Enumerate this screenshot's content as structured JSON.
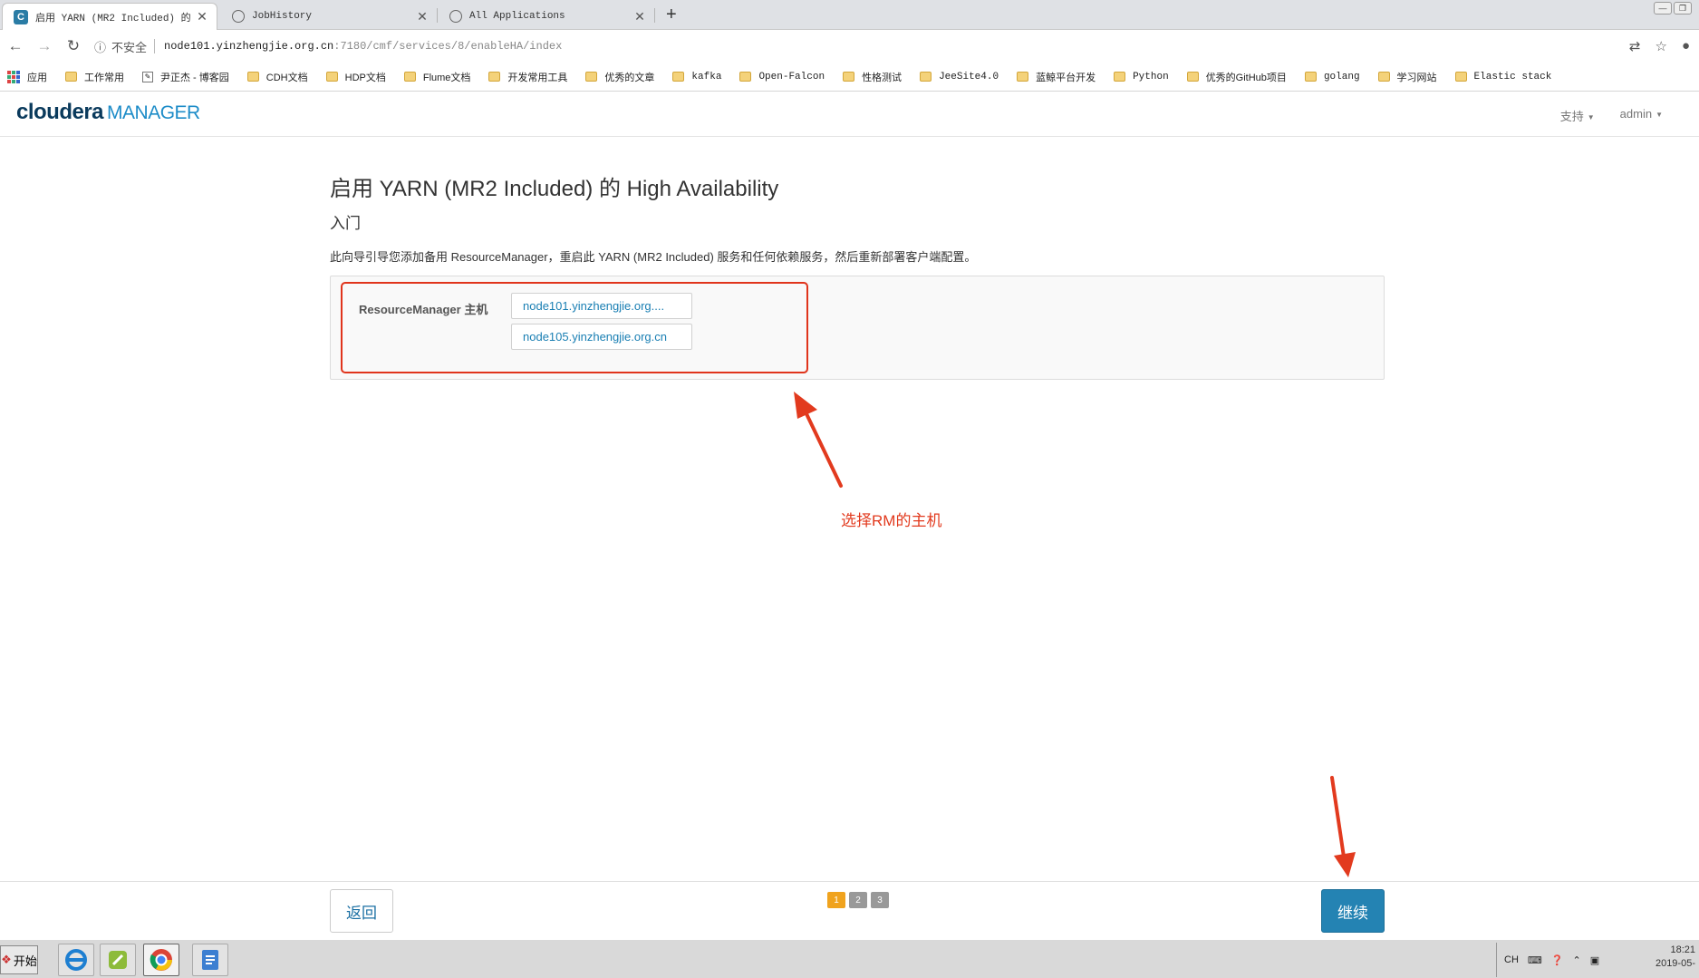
{
  "browser": {
    "tabs": [
      {
        "title": "启用 YARN (MR2 Included) 的 H",
        "active": true,
        "favicon": "cloudera-favicon"
      },
      {
        "title": "JobHistory",
        "active": false,
        "favicon": "globe-icon"
      },
      {
        "title": "All Applications",
        "active": false,
        "favicon": "globe-icon"
      }
    ],
    "new_tab": "+",
    "address": {
      "security": "不安全",
      "host": "node101.yinzhengjie.org.cn",
      "path": ":7180/cmf/services/8/enableHA/index"
    },
    "bookmarks": [
      {
        "label": "应用",
        "type": "apps"
      },
      {
        "label": "工作常用",
        "type": "folder"
      },
      {
        "label": "尹正杰 - 博客园",
        "type": "page"
      },
      {
        "label": "CDH文档",
        "type": "folder"
      },
      {
        "label": "HDP文档",
        "type": "folder"
      },
      {
        "label": "Flume文档",
        "type": "folder"
      },
      {
        "label": "开发常用工具",
        "type": "folder"
      },
      {
        "label": "优秀的文章",
        "type": "folder"
      },
      {
        "label": "kafka",
        "type": "folder"
      },
      {
        "label": "Open-Falcon",
        "type": "folder"
      },
      {
        "label": "性格测试",
        "type": "folder"
      },
      {
        "label": "JeeSite4.0",
        "type": "folder"
      },
      {
        "label": "蓝鲸平台开发",
        "type": "folder"
      },
      {
        "label": "Python",
        "type": "folder"
      },
      {
        "label": "优秀的GitHub项目",
        "type": "folder"
      },
      {
        "label": "golang",
        "type": "folder"
      },
      {
        "label": "学习网站",
        "type": "folder"
      },
      {
        "label": "Elastic stack",
        "type": "folder"
      }
    ]
  },
  "cm_header": {
    "logo_primary": "cloudera",
    "logo_secondary": "MANAGER",
    "support_label": "支持",
    "user_label": "admin"
  },
  "wizard": {
    "title": "启用 YARN (MR2 Included) 的 High Availability",
    "subtitle": "入门",
    "description": "此向导引导您添加备用 ResourceManager，重启此 YARN (MR2 Included) 服务和任何依赖服务，然后重新部署客户端配置。",
    "rm_label": "ResourceManager 主机",
    "hosts": [
      "node101.yinzhengjie.org....",
      "node105.yinzhengjie.org.cn"
    ],
    "annotation": "选择RM的主机",
    "annotation_color": "#e23a1e"
  },
  "footer": {
    "back_label": "返回",
    "next_label": "继续",
    "steps": [
      "1",
      "2",
      "3"
    ],
    "current_step": "1"
  },
  "taskbar": {
    "start_label": "开始",
    "lang": "CH",
    "time": "18:21",
    "date": "2019-05-"
  }
}
